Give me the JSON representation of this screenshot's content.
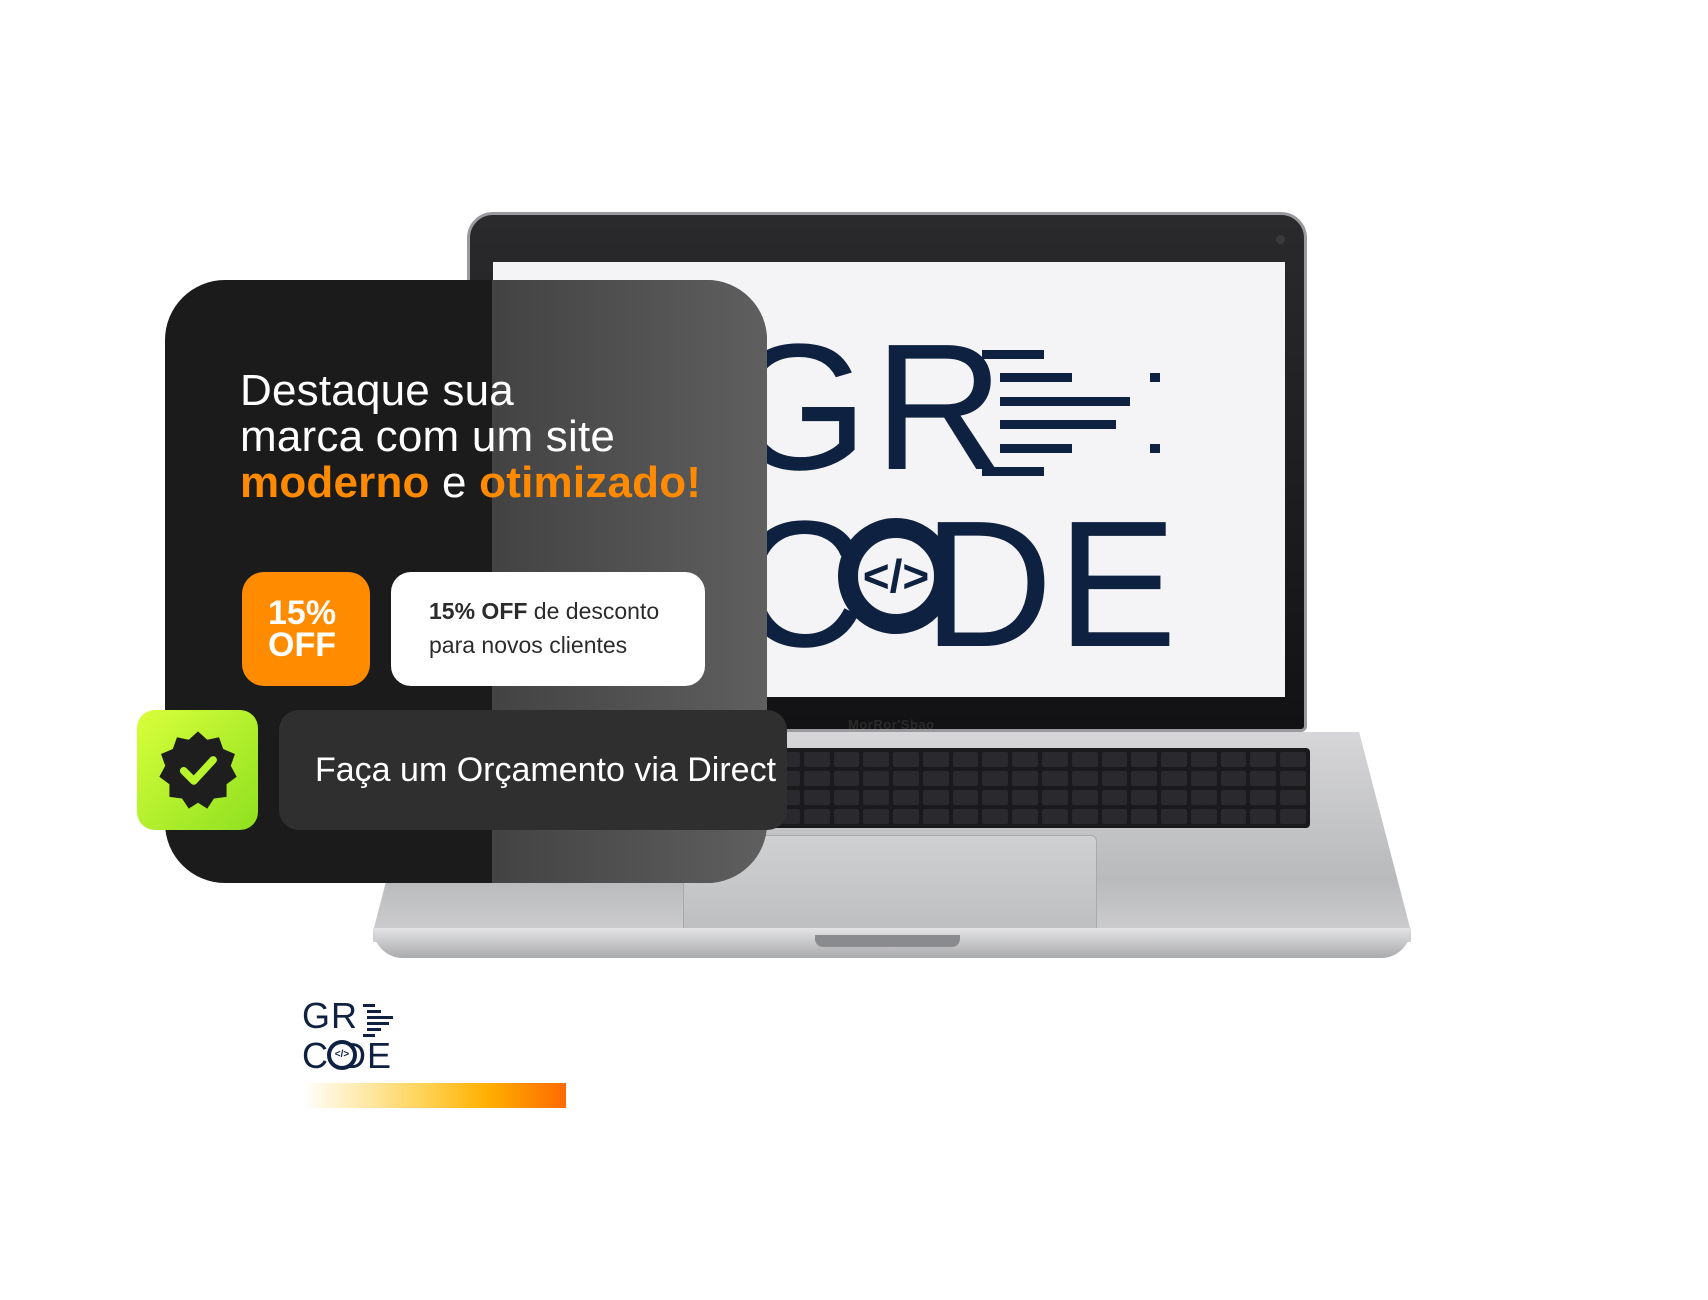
{
  "laptop": {
    "screen_logo_top": "GR",
    "screen_logo_bottom": "C   DE",
    "screen_logo_symbol": "</>",
    "brand_label": "MorRor'Sbao"
  },
  "card": {
    "headline_line1": "Destaque sua",
    "headline_line2_a": "marca",
    "headline_line2_b": " com um site",
    "headline_line3_accent1": "moderno",
    "headline_line3_mid": " e ",
    "headline_line3_accent2": "otimizado!",
    "badge_line1": "15%",
    "badge_line2": "OFF",
    "discount_bold": "15% OFF",
    "discount_rest": " de desconto",
    "discount_line2": "para novos clientes",
    "cta_label": "Faça um Orçamento via Direct"
  },
  "footer_logo": {
    "line1": "GR",
    "line2": "C DE",
    "symbol": "</>"
  },
  "colors": {
    "accent_orange": "#ff8a00",
    "brand_navy": "#0f2140",
    "badge_green": "#b8f52c",
    "card_dark": "#1b1b1b"
  },
  "icons": {
    "verify": "verified-badge-icon"
  }
}
